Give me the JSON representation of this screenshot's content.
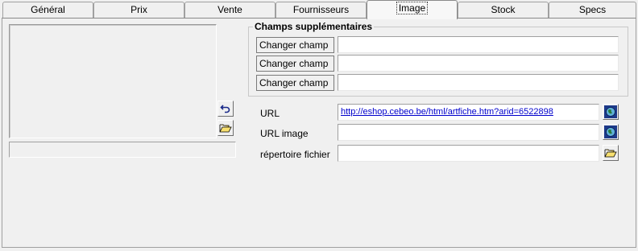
{
  "tabs": [
    {
      "label": "Général"
    },
    {
      "label": "Prix"
    },
    {
      "label": "Vente"
    },
    {
      "label": "Fournisseurs"
    },
    {
      "label": "Image"
    },
    {
      "label": "Stock"
    },
    {
      "label": "Specs"
    }
  ],
  "extra_fields": {
    "title": "Champs supplémentaires",
    "rows": [
      {
        "label": "Changer champ",
        "value": ""
      },
      {
        "label": "Changer champ",
        "value": ""
      },
      {
        "label": "Changer champ",
        "value": ""
      }
    ]
  },
  "url": {
    "label": "URL",
    "value": "http://eshop.cebeo.be/html/artfiche.htm?arid=6522898"
  },
  "url_image": {
    "label": "URL image",
    "value": ""
  },
  "file_dir": {
    "label": "répertoire fichier",
    "value": ""
  },
  "icons": {
    "undo": "undo-icon",
    "folder": "open-folder-icon",
    "globe": "globe-icon"
  }
}
